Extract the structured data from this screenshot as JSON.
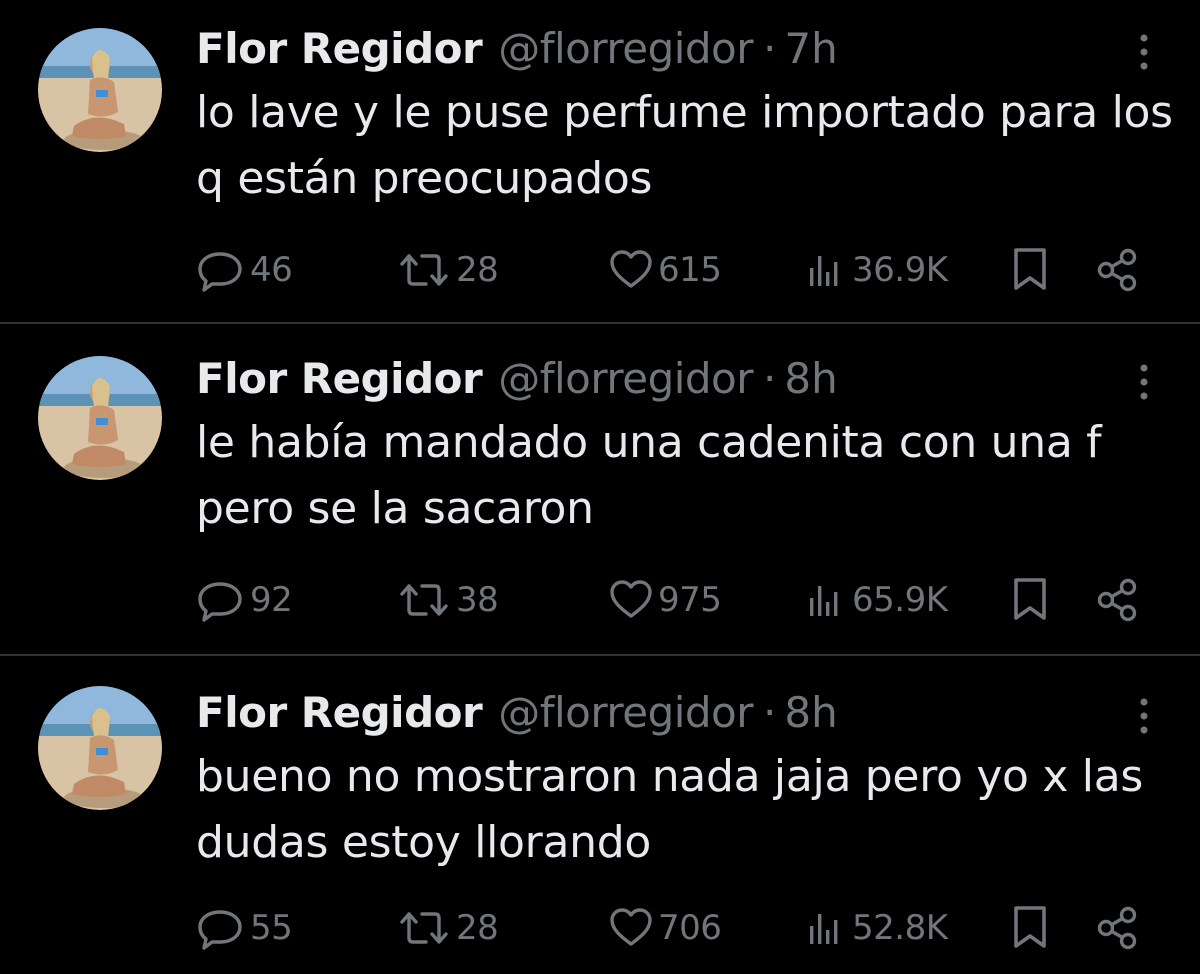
{
  "tweets": [
    {
      "display_name": "Flor Regidor",
      "handle": "@florregidor",
      "separator": "·",
      "time": "7h",
      "text": "lo lave y le puse perfume importado para los q están preocupados",
      "replies": "46",
      "retweets": "28",
      "likes": "615",
      "views": "36.9K"
    },
    {
      "display_name": "Flor Regidor",
      "handle": "@florregidor",
      "separator": "·",
      "time": "8h",
      "text": "le había mandado una cadenita con una f pero se la sacaron",
      "replies": "92",
      "retweets": "38",
      "likes": "975",
      "views": "65.9K"
    },
    {
      "display_name": "Flor Regidor",
      "handle": "@florregidor",
      "separator": "·",
      "time": "8h",
      "text": "bueno no mostraron nada jaja pero yo x las dudas estoy llorando",
      "replies": "55",
      "retweets": "28",
      "likes": "706",
      "views": "52.8K"
    }
  ],
  "icons": {
    "reply": "speech-bubble-icon",
    "retweet": "retweet-arrows-icon",
    "like": "heart-icon",
    "views": "bar-chart-icon",
    "bookmark": "bookmark-icon",
    "share": "share-icon",
    "more": "vertical-ellipsis-icon"
  },
  "colors": {
    "background": "#000000",
    "primary_text": "#e7e9ea",
    "secondary_text": "#71767b",
    "divider": "#2f3336"
  }
}
